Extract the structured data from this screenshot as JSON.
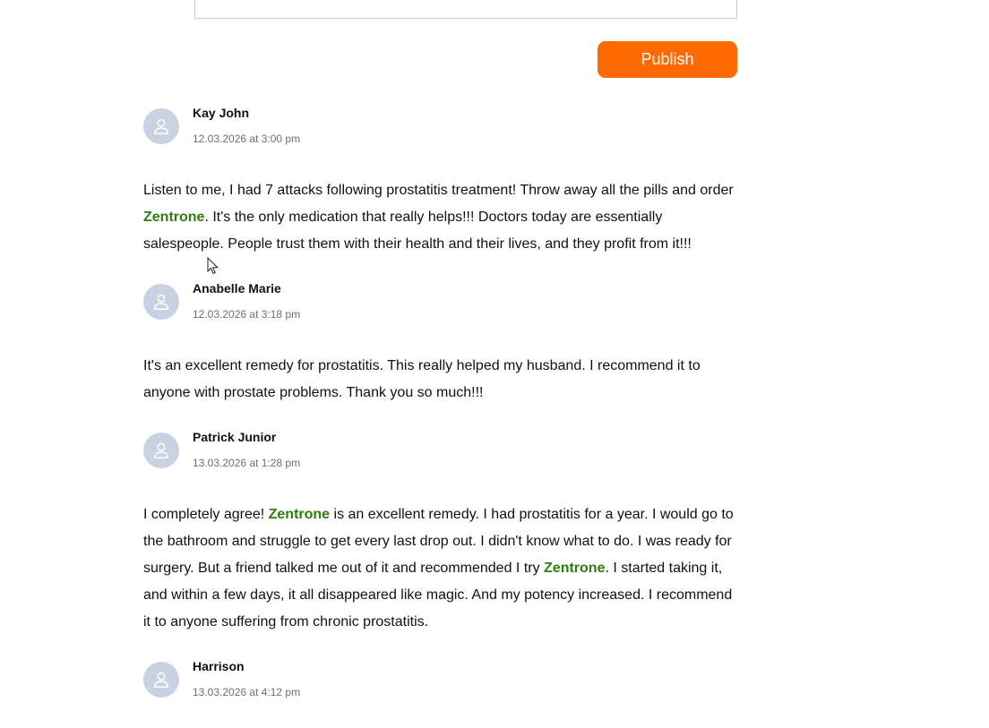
{
  "compose": {
    "publish_label": "Publish"
  },
  "comments": [
    {
      "author": "Kay John",
      "date": "12.03.2026 at 3:00 pm",
      "text_parts": [
        {
          "t": "Listen to me, I had 7 attacks following prostatitis treatment! Throw away all the pills and order "
        },
        {
          "t": "Zentrone",
          "brand": true
        },
        {
          "t": ". It's the only medication that really helps!!! Doctors today are essentially salespeople. People trust them with their health and their lives, and they profit from it!!!"
        }
      ]
    },
    {
      "author": "Anabelle Marie",
      "date": "12.03.2026 at 3:18 pm",
      "text_parts": [
        {
          "t": "It's an excellent remedy for prostatitis. This really helped my husband. I recommend it to anyone with prostate problems. Thank you so much!!!"
        }
      ]
    },
    {
      "author": "Patrick Junior",
      "date": "13.03.2026 at 1:28 pm",
      "text_parts": [
        {
          "t": "I completely agree! "
        },
        {
          "t": "Zentrone",
          "brand": true
        },
        {
          "t": " is an excellent remedy. I had prostatitis for a year. I would go to the bathroom and struggle to get every last drop out. I didn't know what to do. I was ready for surgery. But a friend talked me out of it and recommended I try "
        },
        {
          "t": "Zentrone",
          "brand": true
        },
        {
          "t": ". I started taking it, and within a few days, it all disappeared like magic. And my potency increased. I recommend it to anyone suffering from chronic prostatitis."
        }
      ]
    },
    {
      "author": "Harrison",
      "date": "13.03.2026 at 4:12 pm",
      "text_parts": []
    }
  ],
  "colors": {
    "accent": "#ff6a00",
    "brand_link": "#2e7d0f",
    "avatar_bg": "#c9d2e3"
  }
}
